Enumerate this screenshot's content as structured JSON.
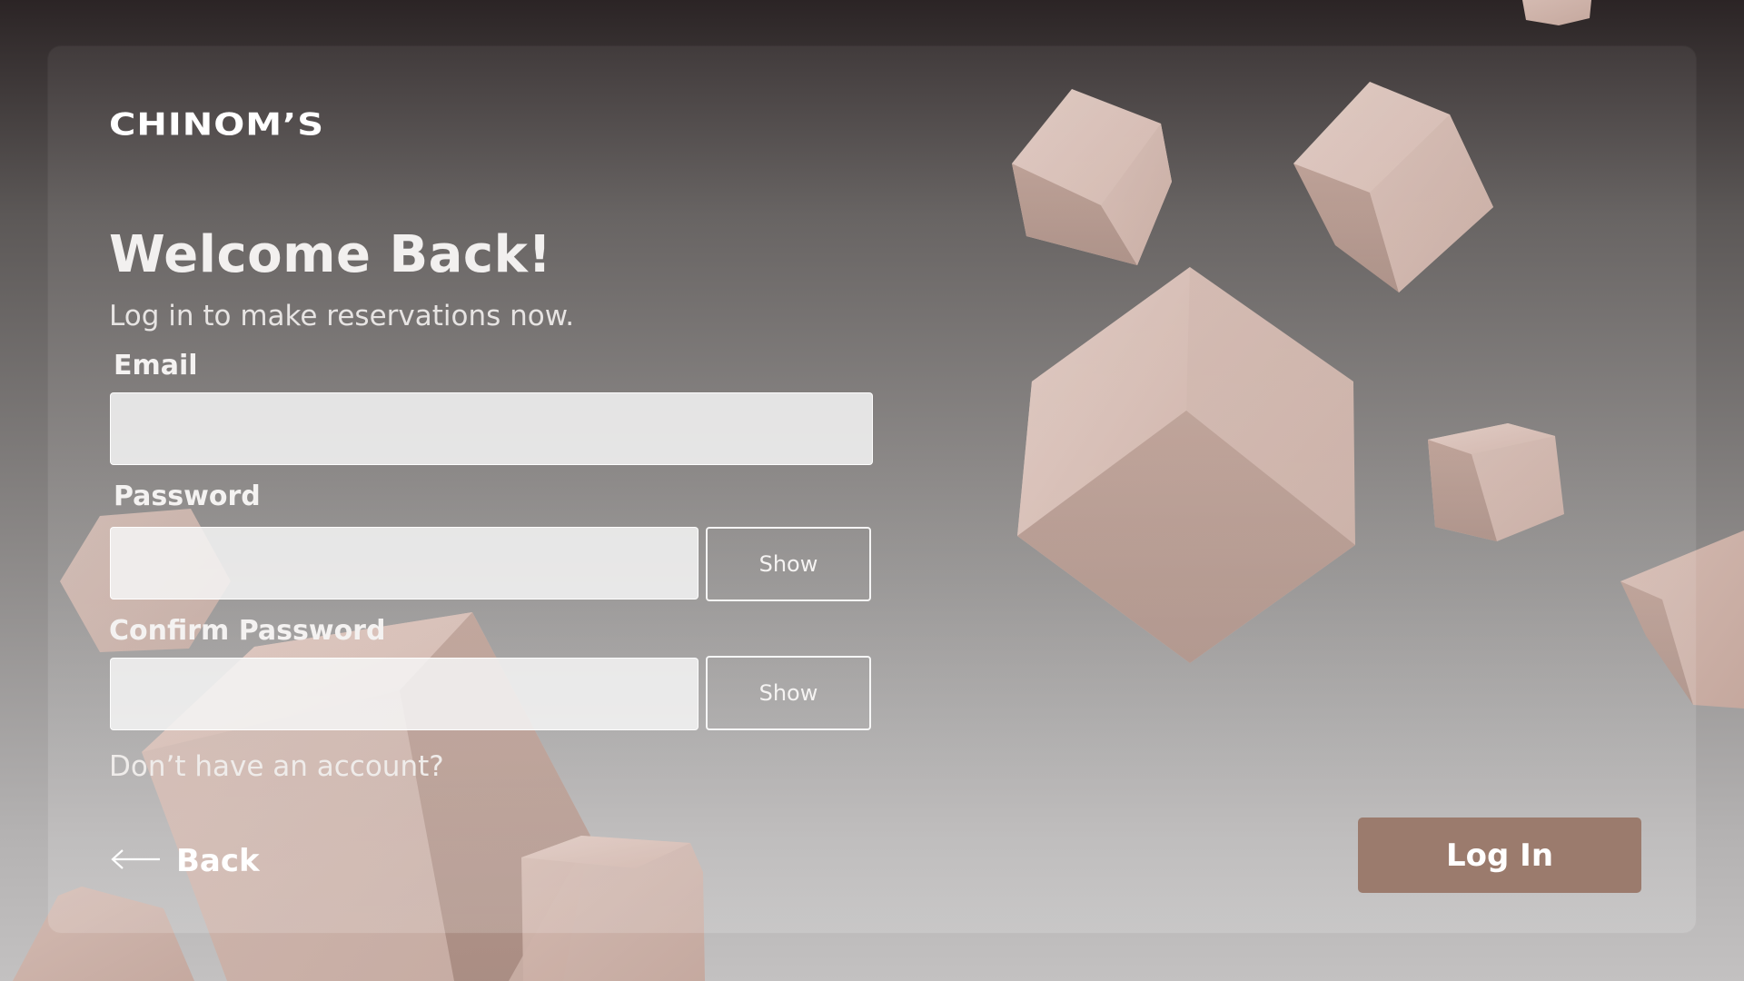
{
  "brand": {
    "logo_text": "CHINOM’S"
  },
  "form": {
    "title": "Welcome Back!",
    "subtitle": "Log in to make reservations now.",
    "email": {
      "label": "Email",
      "value": "",
      "placeholder": ""
    },
    "password": {
      "label": "Password",
      "value": "",
      "placeholder": "",
      "toggle_label": "Show"
    },
    "confirm_password": {
      "label": "Confirm Password",
      "value": "",
      "placeholder": "",
      "toggle_label": "Show"
    },
    "signup_prompt": "Don’t have an account?",
    "back_label": "Back",
    "submit_label": "Log In"
  },
  "icons": {
    "back": "arrow-left-icon"
  },
  "colors": {
    "accent": "#9b7b6d",
    "cube": "#c9aca3",
    "text": "#ffffff"
  }
}
